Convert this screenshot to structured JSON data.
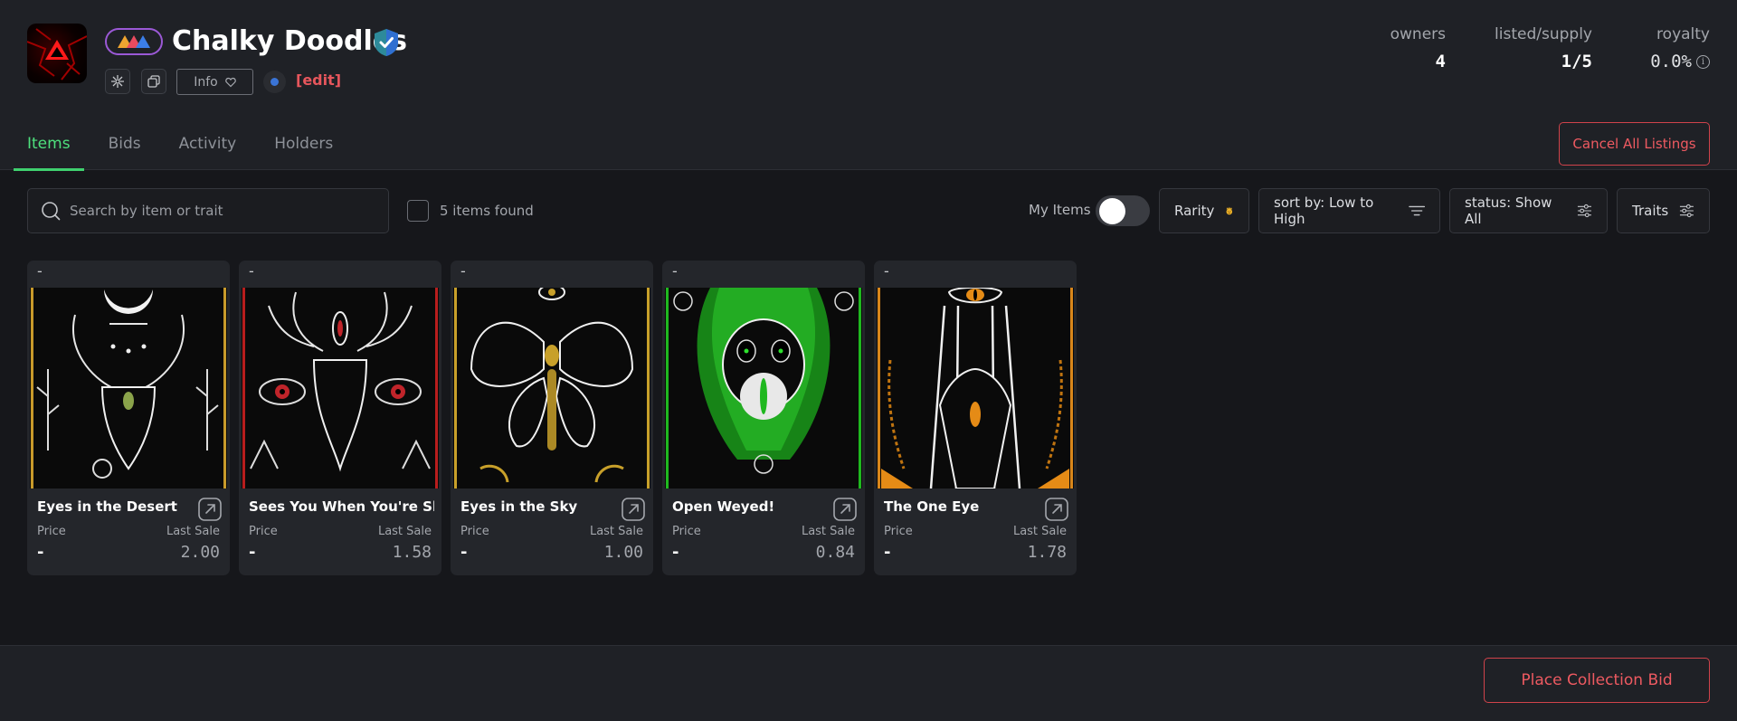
{
  "collection": {
    "name": "Chalky Doodles",
    "info_label": "Info",
    "edit_label": "[edit]"
  },
  "stats": [
    {
      "label": "owners",
      "value": "4"
    },
    {
      "label": "listed/supply",
      "value": "1/5"
    },
    {
      "label": "royalty",
      "value": "0.0%"
    }
  ],
  "tabs": [
    {
      "label": "Items",
      "active": true
    },
    {
      "label": "Bids",
      "active": false
    },
    {
      "label": "Activity",
      "active": false
    },
    {
      "label": "Holders",
      "active": false
    }
  ],
  "actions": {
    "cancel_all": "Cancel All Listings",
    "place_bid": "Place Collection Bid"
  },
  "toolbar": {
    "search_placeholder": "Search by item or trait",
    "found_text": "5 items found",
    "my_items_label": "My Items",
    "rarity_label": "Rarity",
    "sort_label": "sort by: Low to High",
    "status_label": "status: Show All",
    "traits_label": "Traits"
  },
  "items": [
    {
      "name": "Eyes in the Desert",
      "price_top": "-",
      "price_label": "Price",
      "price": "-",
      "last_sale_label": "Last Sale",
      "last_sale": "2.00",
      "accent": "#c89a2a"
    },
    {
      "name": "Sees You When You're Sleeping",
      "price_top": "-",
      "price_label": "Price",
      "price": "-",
      "last_sale_label": "Last Sale",
      "last_sale": "1.58",
      "accent": "#b81d1d"
    },
    {
      "name": "Eyes in the Sky",
      "price_top": "-",
      "price_label": "Price",
      "price": "-",
      "last_sale_label": "Last Sale",
      "last_sale": "1.00",
      "accent": "#c8a02a"
    },
    {
      "name": "Open Weyed!",
      "price_top": "-",
      "price_label": "Price",
      "price": "-",
      "last_sale_label": "Last Sale",
      "last_sale": "0.84",
      "accent": "#1fb81f"
    },
    {
      "name": "The One Eye",
      "price_top": "-",
      "price_label": "Price",
      "price": "-",
      "last_sale_label": "Last Sale",
      "last_sale": "1.78",
      "accent": "#d9861a"
    }
  ]
}
